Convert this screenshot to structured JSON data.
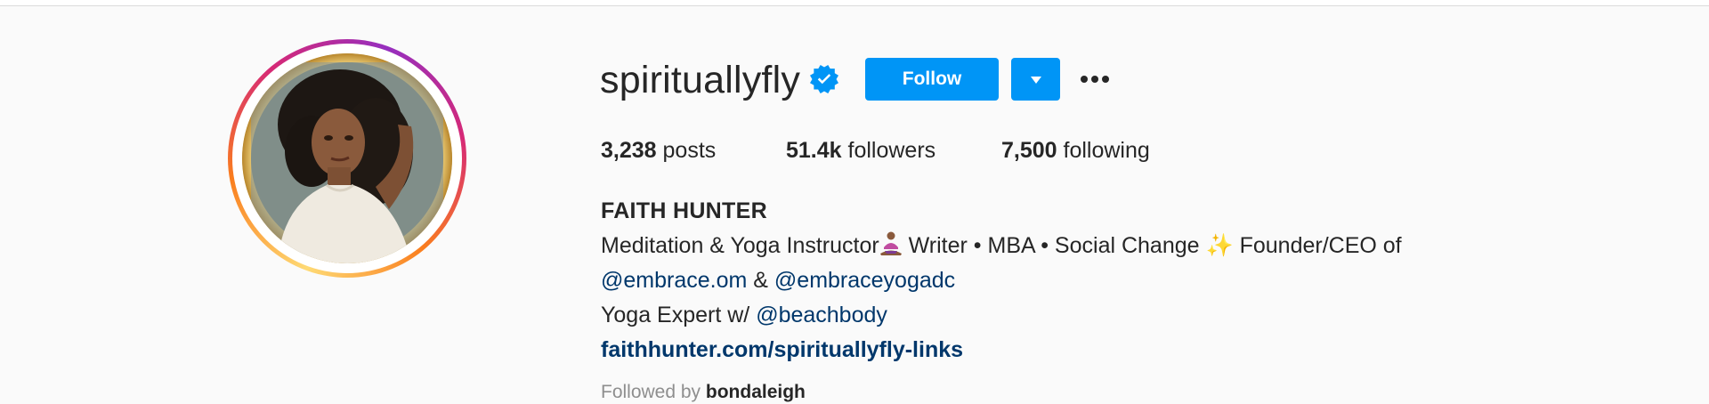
{
  "profile": {
    "username": "spirituallyfly",
    "verified": true,
    "follow_label": "Follow",
    "stats": {
      "posts_count": "3,238",
      "posts_label": "posts",
      "followers_count": "51.4k",
      "followers_label": "followers",
      "following_count": "7,500",
      "following_label": "following"
    },
    "bio": {
      "full_name": "FAITH HUNTER",
      "line1_text": "Meditation & Yoga Instructor",
      "line1_emoji": "person-in-lotus-position",
      "line1_text2": " Writer • MBA • Social Change ",
      "line1_emoji2": "✨",
      "line1_text3": " Founder/CEO of",
      "mention1": "@embrace.om",
      "amp": " & ",
      "mention2": "@embraceyogadc",
      "line3_text": "Yoga Expert w/ ",
      "mention3": "@beachbody",
      "website": "faithhunter.com/spirituallyfly-links"
    },
    "followed_by_prefix": "Followed by ",
    "followed_by_user": "bondaleigh"
  },
  "colors": {
    "accent": "#0095f6",
    "link": "#00376b",
    "text": "#262626",
    "background": "#fafafa"
  },
  "icons": {
    "verified": "verified-badge-icon",
    "dropdown": "chevron-down-icon",
    "more": "more-options-icon"
  }
}
